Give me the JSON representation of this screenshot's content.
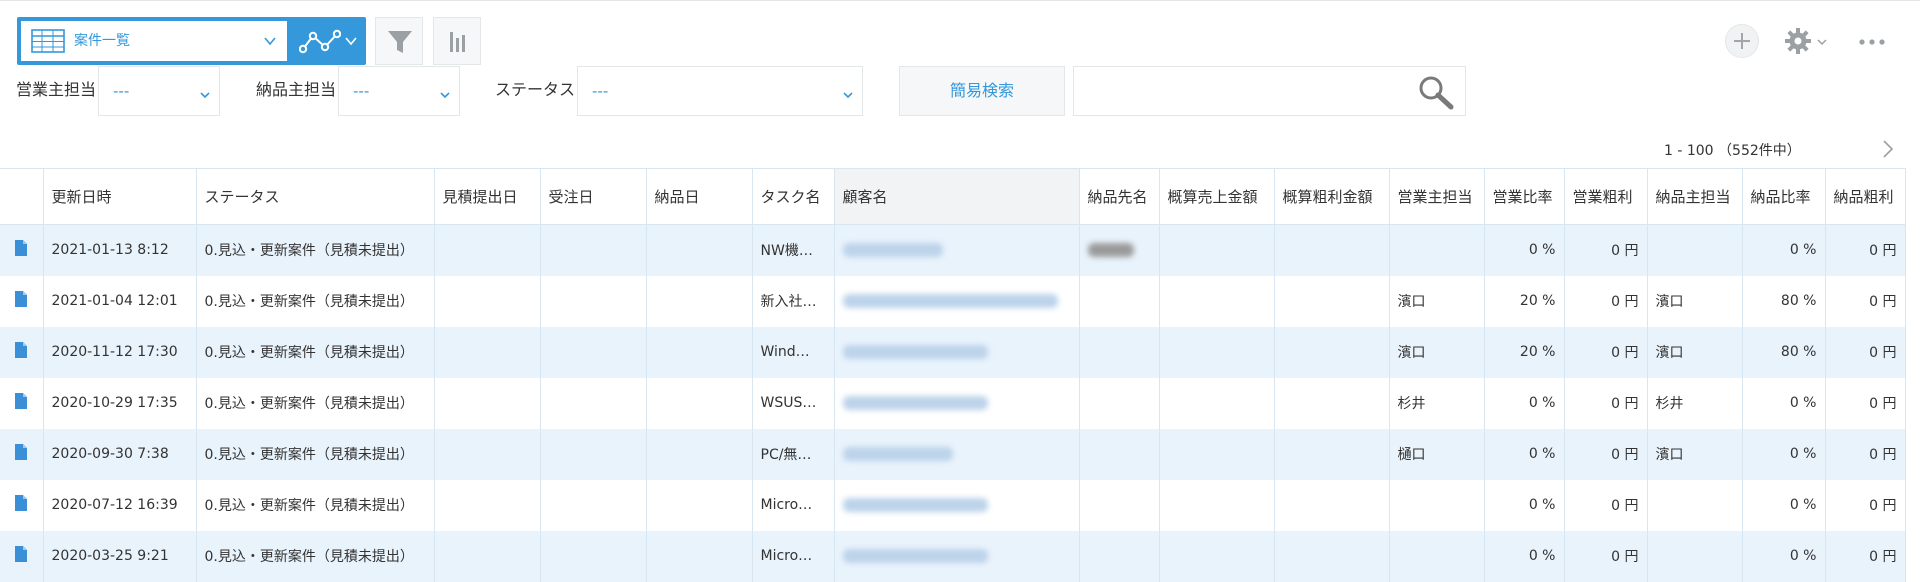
{
  "toolbar": {
    "view_name": "案件一覧",
    "icons": {
      "table": "table-icon",
      "graph": "graph-icon",
      "filter": "filter-icon",
      "chart": "bar-chart-icon",
      "add": "plus-icon",
      "settings": "gear-icon",
      "more": "more-icon"
    }
  },
  "filters": {
    "sales_owner_label": "営業主担当",
    "sales_owner_value": "---",
    "delivery_owner_label": "納品主担当",
    "delivery_owner_value": "---",
    "status_label": "ステータス",
    "status_value": "---",
    "quick_search_label": "簡易検索",
    "search_value": ""
  },
  "pagination": {
    "range": "1 - 100 （552件中）"
  },
  "colors": {
    "accent": "#3498db",
    "row_alt": "#e9f3fc",
    "border": "#d8e6f2"
  },
  "table": {
    "columns": [
      "",
      "更新日時",
      "ステータス",
      "見積提出日",
      "受注日",
      "納品日",
      "タスク名",
      "顧客名",
      "納品先名",
      "概算売上金額",
      "概算粗利金額",
      "営業主担当",
      "営業比率",
      "営業粗利",
      "納品主担当",
      "納品比率",
      "納品粗利"
    ],
    "rows": [
      {
        "updated": "2021-01-13 8:12",
        "status": "0.見込・更新案件（見積未提出）",
        "quote_date": "",
        "order_date": "",
        "delivery_date": "",
        "task": "NW機…",
        "sales_owner": "",
        "sales_ratio": "0 %",
        "sales_profit": "0 円",
        "delivery_owner": "",
        "delivery_ratio": "0 %",
        "delivery_profit": "0 円"
      },
      {
        "updated": "2021-01-04 12:01",
        "status": "0.見込・更新案件（見積未提出）",
        "quote_date": "",
        "order_date": "",
        "delivery_date": "",
        "task": "新入社…",
        "sales_owner": "濱口",
        "sales_ratio": "20 %",
        "sales_profit": "0 円",
        "delivery_owner": "濱口",
        "delivery_ratio": "80 %",
        "delivery_profit": "0 円"
      },
      {
        "updated": "2020-11-12 17:30",
        "status": "0.見込・更新案件（見積未提出）",
        "quote_date": "",
        "order_date": "",
        "delivery_date": "",
        "task": "Wind…",
        "sales_owner": "濱口",
        "sales_ratio": "20 %",
        "sales_profit": "0 円",
        "delivery_owner": "濱口",
        "delivery_ratio": "80 %",
        "delivery_profit": "0 円"
      },
      {
        "updated": "2020-10-29 17:35",
        "status": "0.見込・更新案件（見積未提出）",
        "quote_date": "",
        "order_date": "",
        "delivery_date": "",
        "task": "WSUS…",
        "sales_owner": "杉井",
        "sales_ratio": "0 %",
        "sales_profit": "0 円",
        "delivery_owner": "杉井",
        "delivery_ratio": "0 %",
        "delivery_profit": "0 円"
      },
      {
        "updated": "2020-09-30 7:38",
        "status": "0.見込・更新案件（見積未提出）",
        "quote_date": "",
        "order_date": "",
        "delivery_date": "",
        "task": "PC/無…",
        "sales_owner": "樋口",
        "sales_ratio": "0 %",
        "sales_profit": "0 円",
        "delivery_owner": "濱口",
        "delivery_ratio": "0 %",
        "delivery_profit": "0 円"
      },
      {
        "updated": "2020-07-12 16:39",
        "status": "0.見込・更新案件（見積未提出）",
        "quote_date": "",
        "order_date": "",
        "delivery_date": "",
        "task": "Micro…",
        "sales_owner": "",
        "sales_ratio": "0 %",
        "sales_profit": "0 円",
        "delivery_owner": "",
        "delivery_ratio": "0 %",
        "delivery_profit": "0 円"
      },
      {
        "updated": "2020-03-25 9:21",
        "status": "0.見込・更新案件（見積未提出）",
        "quote_date": "",
        "order_date": "",
        "delivery_date": "",
        "task": "Micro…",
        "sales_owner": "",
        "sales_ratio": "0 %",
        "sales_profit": "0 円",
        "delivery_owner": "",
        "delivery_ratio": "0 %",
        "delivery_profit": "0 円"
      }
    ]
  }
}
